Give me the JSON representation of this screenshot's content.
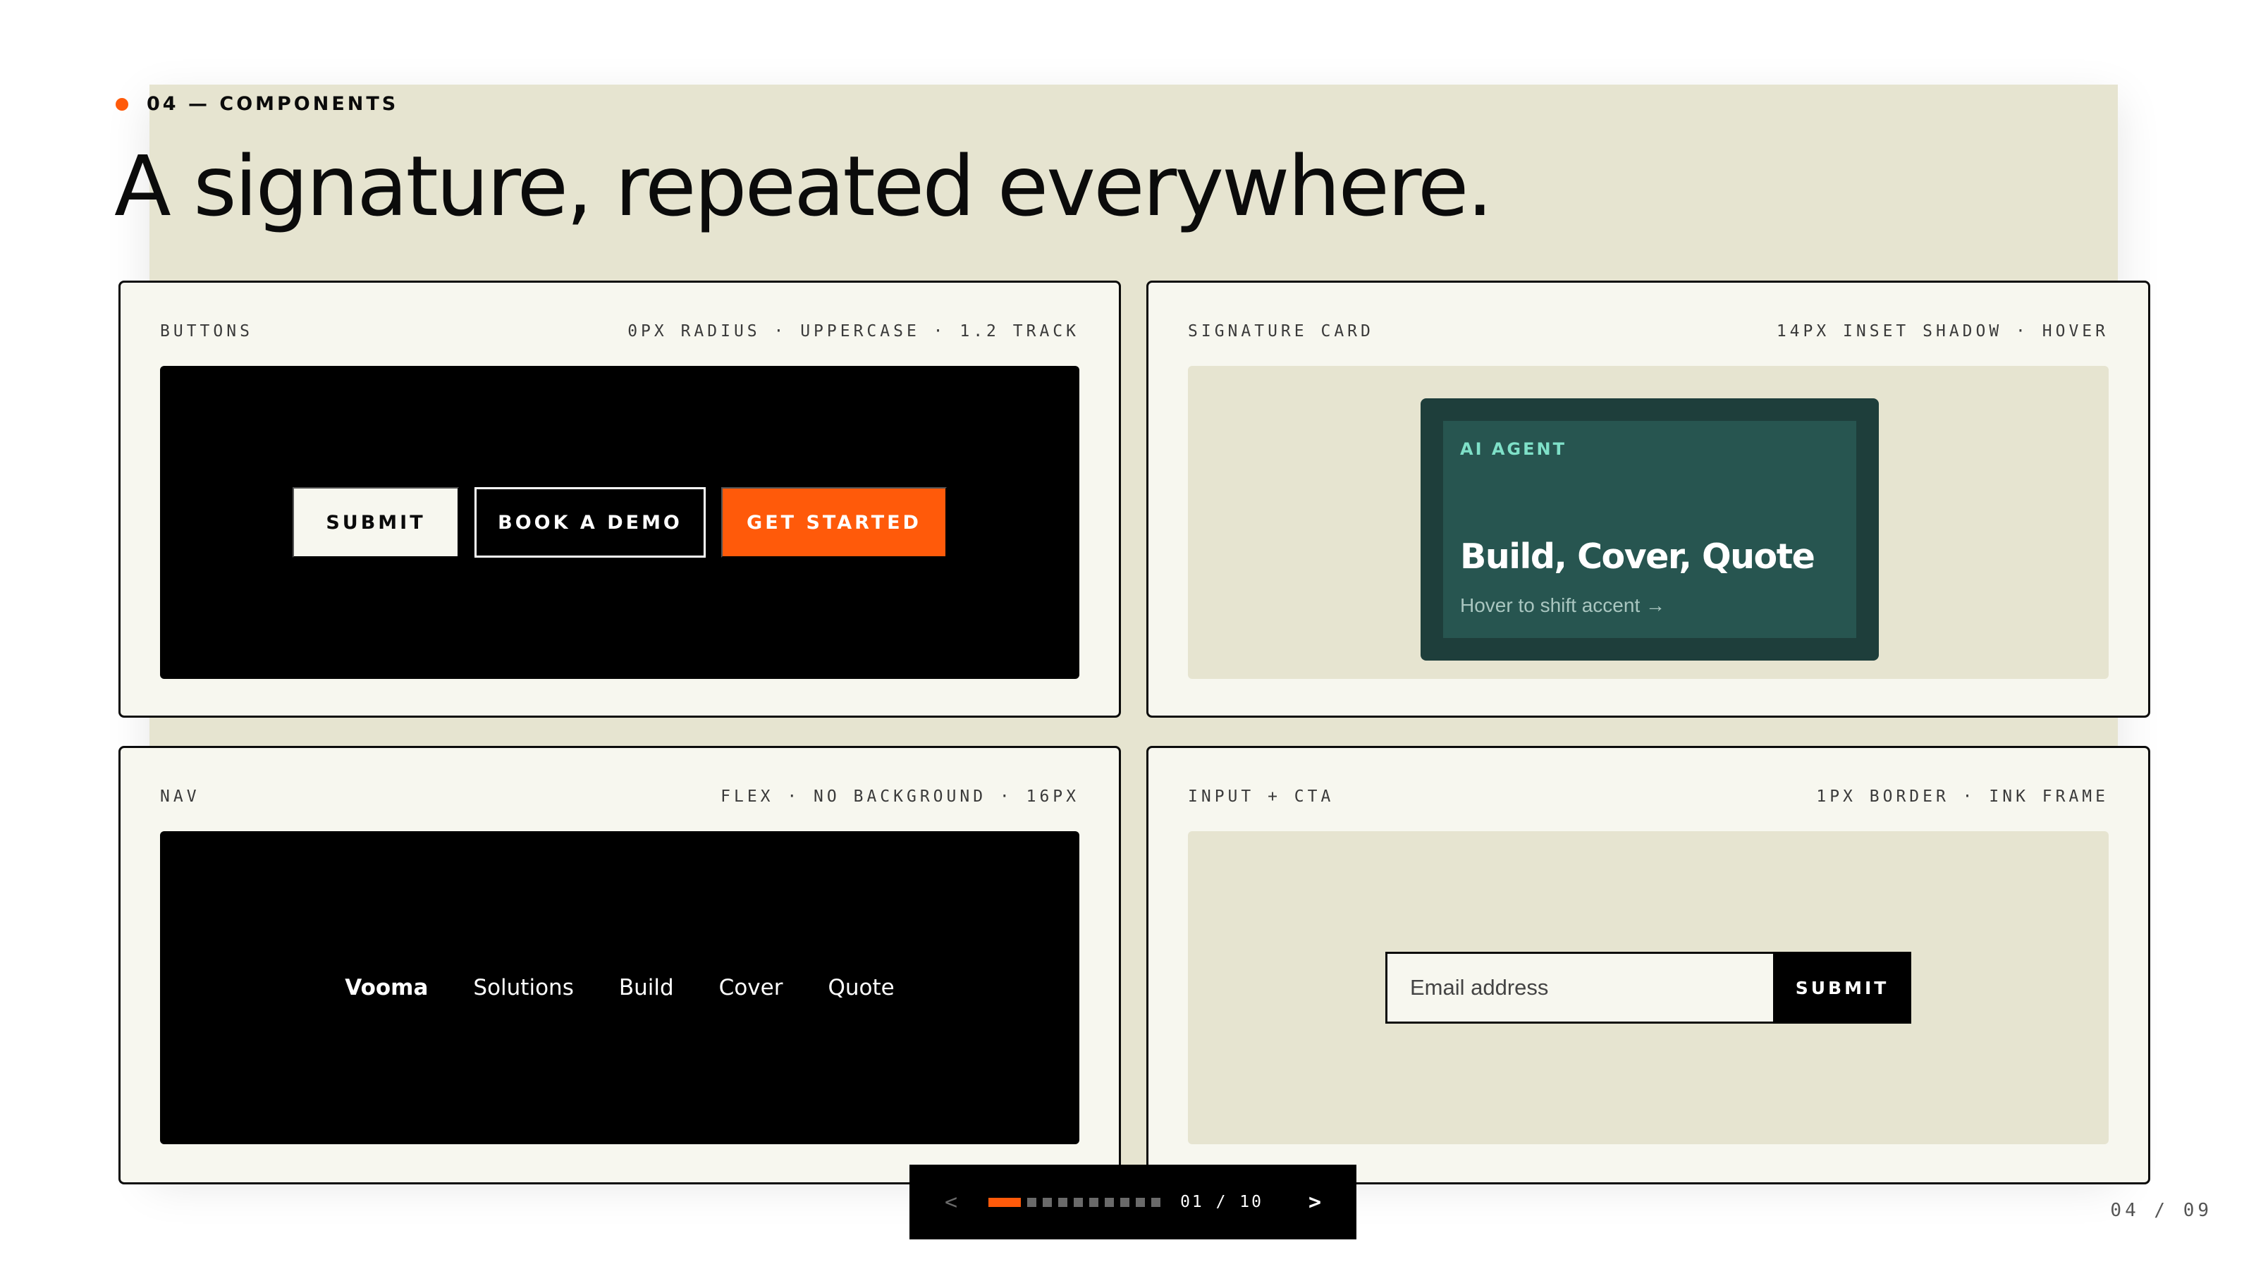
{
  "eyebrow": "04 — COMPONENTS",
  "headline": "A signature, repeated everywhere.",
  "colors": {
    "accent": "#ff5a0a",
    "ink": "#0b0b0b",
    "paper": "#f7f7ef",
    "sand": "#e6e4d0",
    "card_dark": "#1e3e3b",
    "card_inner": "#275550",
    "card_tag": "#7fe0c8"
  },
  "panels": {
    "buttons": {
      "title": "BUTTONS",
      "meta": "0PX RADIUS · UPPERCASE · 1.2 TRACK",
      "submit": "SUBMIT",
      "demo": "BOOK A DEMO",
      "start": "GET STARTED"
    },
    "signature": {
      "title": "SIGNATURE CARD",
      "meta": "14PX INSET SHADOW · HOVER",
      "card_tag": "AI AGENT",
      "card_title": "Build, Cover, Quote",
      "card_sub": "Hover to shift accent →"
    },
    "nav": {
      "title": "NAV",
      "meta": "FLEX · NO BACKGROUND · 16PX",
      "items": [
        "Vooma",
        "Solutions",
        "Build",
        "Cover",
        "Quote"
      ]
    },
    "input": {
      "title": "INPUT + CTA",
      "meta": "1PX BORDER · INK FRAME",
      "placeholder": "Email address",
      "cta": "SUBMIT"
    }
  },
  "pager": {
    "prev": "<",
    "next": ">",
    "counter": "01 / 10",
    "active_index": 0,
    "total": 10
  },
  "slide_number": "04 / 09"
}
